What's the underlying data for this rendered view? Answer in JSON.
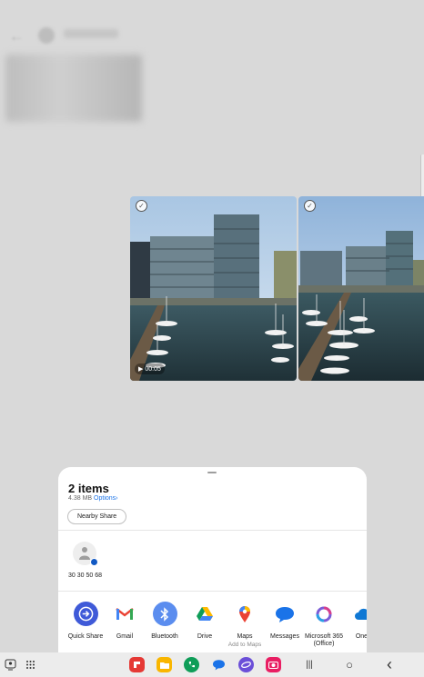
{
  "share_sheet": {
    "title": "2 items",
    "size": "4.38 MB",
    "options_label": "Options",
    "options_chevron": "›",
    "nearby_share_label": "Nearby Share",
    "contact": {
      "name": "30 30 50 68",
      "icon": "person-icon",
      "badge_icon": "messages-badge-icon"
    },
    "apps": [
      {
        "label": "Quick Share",
        "sub": "",
        "icon": "quick-share-icon",
        "color": "#3f5ad8"
      },
      {
        "label": "Gmail",
        "sub": "",
        "icon": "gmail-icon",
        "color": "#ea4335"
      },
      {
        "label": "Bluetooth",
        "sub": "",
        "icon": "bluetooth-icon",
        "color": "#5b8def"
      },
      {
        "label": "Drive",
        "sub": "",
        "icon": "drive-icon",
        "color": "#1fa463"
      },
      {
        "label": "Maps",
        "sub": "Add to Maps",
        "icon": "maps-icon",
        "color": "#ea4335"
      },
      {
        "label": "Messages",
        "sub": "",
        "icon": "messages-icon",
        "color": "#1a73e8"
      },
      {
        "label": "Microsoft 365 (Office)",
        "sub": "",
        "icon": "microsoft-365-icon",
        "color": "#7b5cd6"
      },
      {
        "label": "OneD",
        "sub": "",
        "icon": "onedrive-icon",
        "color": "#0f78d4"
      }
    ]
  },
  "gallery": {
    "items": [
      {
        "type": "video",
        "duration": "00:05",
        "selected": true
      },
      {
        "type": "image",
        "selected": true
      }
    ],
    "check_glyph": "✓",
    "play_glyph": "▶"
  },
  "navbar": {
    "left_icons": [
      "assistant-icon",
      "apps-grid-icon"
    ],
    "dock": [
      {
        "icon": "flipboard-icon",
        "color": "#e53935"
      },
      {
        "icon": "files-icon",
        "color": "#f9b600"
      },
      {
        "icon": "phone-icon",
        "color": "#0f9d58"
      },
      {
        "icon": "messages-icon",
        "color": "#1a73e8"
      },
      {
        "icon": "internet-icon",
        "color": "#6b4fd8"
      },
      {
        "icon": "camera-icon",
        "color": "#e91e63"
      }
    ],
    "recents_glyph": "|||",
    "home_glyph": "○",
    "back_glyph": "‹"
  }
}
